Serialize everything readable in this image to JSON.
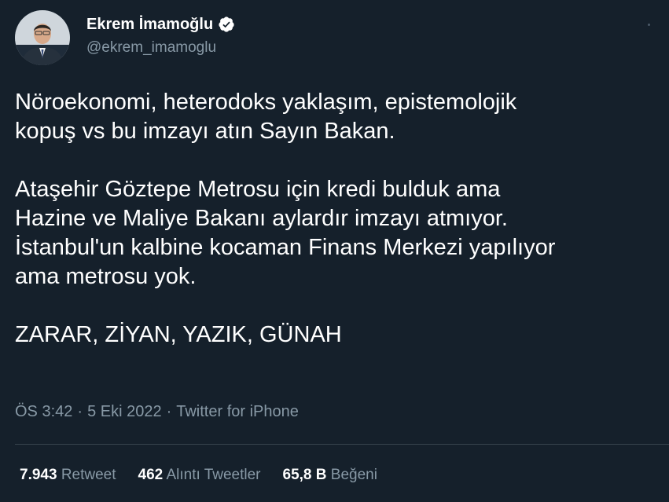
{
  "author": {
    "display_name": "Ekrem İmamoğlu",
    "handle": "@ekrem_imamoglu",
    "verified": true,
    "avatar_icon": "profile-photo"
  },
  "tweet": {
    "lines_p1": [
      "Nöroekonomi, heterodoks yaklaşım, epistemolojik",
      "kopuş vs bu imzayı atın Sayın Bakan."
    ],
    "lines_p2": [
      "Ataşehir Göztepe Metrosu için kredi bulduk ama",
      "Hazine ve Maliye Bakanı aylardır imzayı atmıyor.",
      "İstanbul'un kalbine kocaman Finans Merkezi yapılıyor",
      "ama metrosu yok."
    ],
    "lines_p3": [
      "ZARAR, ZİYAN, YAZIK, GÜNAH"
    ]
  },
  "meta": {
    "time": "ÖS 3:42",
    "date": "5 Eki 2022",
    "source": "Twitter for iPhone",
    "separator": "·"
  },
  "stats": {
    "retweets_count": "7.943",
    "retweets_label": "Retweet",
    "quotes_count": "462",
    "quotes_label": "Alıntı Tweetler",
    "likes_count": "65,8 B",
    "likes_label": "Beğeni"
  },
  "colors": {
    "background": "#15202b",
    "text_primary": "#ffffff",
    "text_secondary": "#8899a6",
    "divider": "#38444d",
    "verified_badge": "#ffffff"
  }
}
